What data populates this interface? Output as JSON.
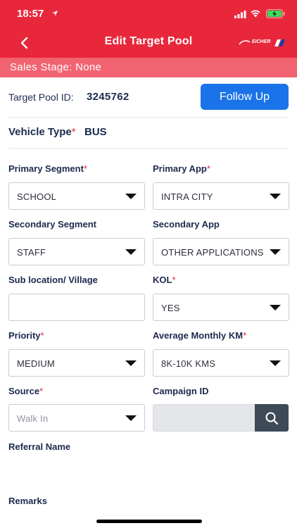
{
  "status_bar": {
    "time": "18:57"
  },
  "nav": {
    "title": "Edit Target Pool",
    "brand": "EICHER"
  },
  "sales_stage": {
    "text": "Sales Stage:  None"
  },
  "target_pool": {
    "label": "Target Pool ID:",
    "value": "3245762",
    "follow_up_label": "Follow Up"
  },
  "vehicle_type": {
    "label": "Vehicle Type",
    "required": "*",
    "value": "BUS"
  },
  "fields": {
    "primary_segment": {
      "label": "Primary Segment",
      "required": "*",
      "value": "SCHOOL"
    },
    "primary_app": {
      "label": "Primary App",
      "required": "*",
      "value": "INTRA CITY"
    },
    "secondary_segment": {
      "label": "Secondary Segment",
      "value": "STAFF"
    },
    "secondary_app": {
      "label": "Secondary App",
      "value": "OTHER APPLICATIONS"
    },
    "sub_location": {
      "label": "Sub location/ Village",
      "value": ""
    },
    "kol": {
      "label": "KOL",
      "required": "*",
      "value": "YES"
    },
    "priority": {
      "label": "Priority",
      "required": "*",
      "value": "MEDIUM"
    },
    "avg_monthly_km": {
      "label": "Average Monthly KM",
      "required": "*",
      "value": "8K-10K KMS"
    },
    "source": {
      "label": "Source",
      "required": "*",
      "placeholder": "Walk In"
    },
    "campaign_id": {
      "label": "Campaign ID",
      "value": ""
    },
    "referral_name": {
      "label": "Referral Name"
    },
    "remarks": {
      "label": "Remarks"
    }
  },
  "icons": {
    "back": "chevron-left-icon",
    "dropdown": "caret-down-icon",
    "search": "search-icon",
    "location": "location-arrow-icon",
    "signal": "signal-icon",
    "wifi": "wifi-icon",
    "battery": "battery-charging-icon"
  },
  "colors": {
    "header": "#e8273b",
    "sales_bar": "#f26371",
    "primary_button": "#1a73e8",
    "search_button": "#3e4a57",
    "text_primary": "#1b2a4e",
    "required": "#e8273b"
  }
}
